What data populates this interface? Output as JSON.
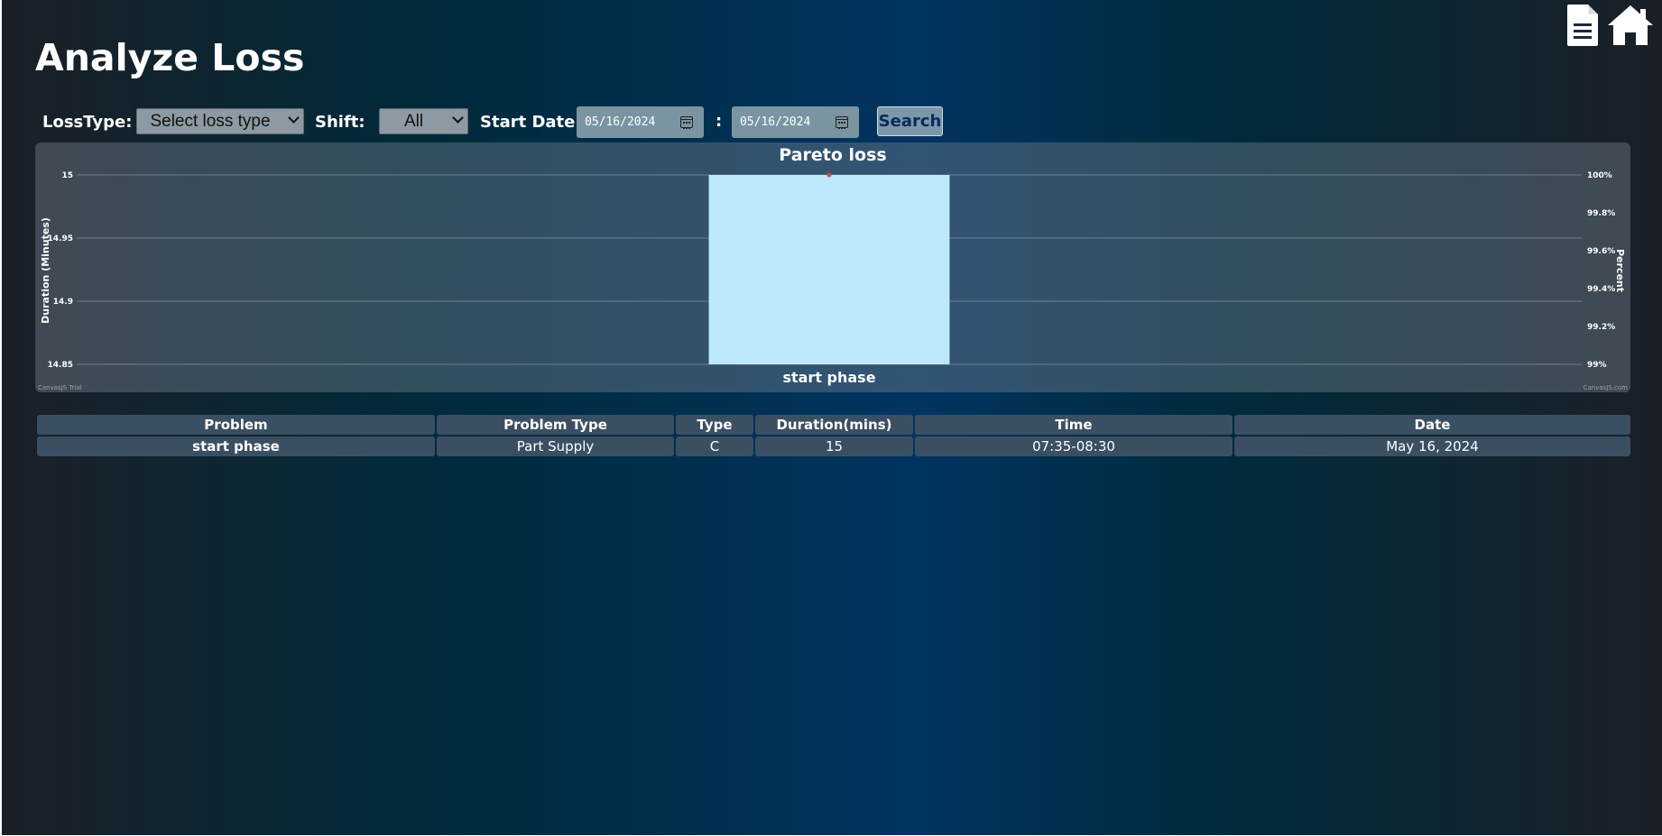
{
  "page": {
    "title": "Analyze Loss"
  },
  "icons": {
    "report": "document-icon",
    "home": "home-icon"
  },
  "filters": {
    "loss_type_label": "LossType:",
    "loss_type_value": "Select loss type",
    "shift_label": "Shift:",
    "shift_value": "All",
    "start_date_label": "Start Date",
    "start_date_value": "05/16/2024",
    "range_separator": ":",
    "end_date_value": "05/16/2024",
    "search_label": "Search"
  },
  "chart_data": {
    "type": "bar",
    "title": "Pareto loss",
    "categories": [
      "start phase"
    ],
    "series": [
      {
        "values": [
          15
        ],
        "color": "#bee9fb"
      },
      {
        "values": [
          100
        ],
        "color": "#c0504e"
      }
    ],
    "ylabel": "Duration (Minutes)",
    "y2label": "Percent",
    "ylim": [
      14.85,
      15
    ],
    "y2lim": [
      99,
      100
    ],
    "y_ticks": [
      "15",
      "14.95",
      "14.9",
      "14.85"
    ],
    "y2_ticks": [
      "100%",
      "99.8%",
      "99.6%",
      "99.4%",
      "99.2%",
      "99%"
    ],
    "grid": true,
    "watermark_left": "CanvasJS Trial",
    "watermark_right": "CanvasJS.com"
  },
  "table": {
    "headers": [
      "Problem",
      "Problem Type",
      "Type",
      "Duration(mins)",
      "Time",
      "Date"
    ],
    "rows": [
      [
        "start phase",
        "Part Supply",
        "C",
        "15",
        "07:35-08:30",
        "May 16, 2024"
      ]
    ]
  },
  "colors": {
    "bar": "#bee9fb",
    "panel": "#5b6878",
    "cell": "#3b4f63",
    "accent": "#0a2b5c"
  }
}
